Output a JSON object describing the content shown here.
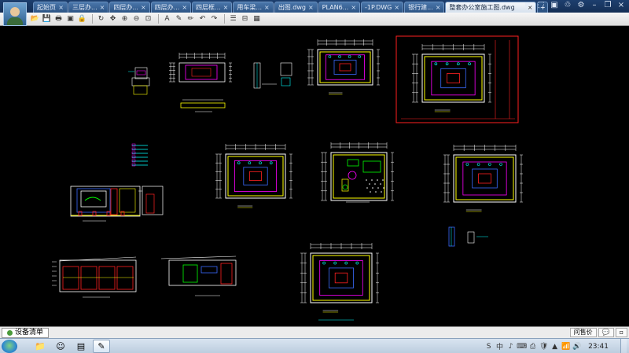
{
  "tabs": [
    {
      "label": "起始页",
      "active": false
    },
    {
      "label": "三层办...",
      "active": false
    },
    {
      "label": "四层办...",
      "active": false
    },
    {
      "label": "四层办...",
      "active": false
    },
    {
      "label": "四层框...",
      "active": false
    },
    {
      "label": "用车梁...",
      "active": false
    },
    {
      "label": "出图.dwg",
      "active": false
    },
    {
      "label": "PLAN6...",
      "active": false
    },
    {
      "label": "-1P.DWG",
      "active": false
    },
    {
      "label": "银行建...",
      "active": false
    },
    {
      "label": "整套办公室施工图.dwg",
      "active": true
    }
  ],
  "new_tab_symbol": "+",
  "close_symbol": "×",
  "window_controls": [
    "≡",
    "⬚",
    "▣",
    "♲",
    "⚙",
    "–",
    "❐",
    "×"
  ],
  "toolbar_icons": [
    "open-icon",
    "save-icon",
    "print-icon",
    "pdf-icon",
    "lock-icon",
    "rotate-icon",
    "pan-icon",
    "zoom-in-icon",
    "zoom-out-icon",
    "zoom-window-icon",
    "text-icon",
    "pen-icon",
    "pencil-icon",
    "undo-icon",
    "redo-icon",
    "layer-icon",
    "measure-icon",
    "layers-icon"
  ],
  "layout": {
    "tab_label": "设备清单",
    "right_buttons": [
      "问售价",
      "💬",
      "▫"
    ]
  },
  "taskbar": {
    "clock": "23:41",
    "tray_icons": [
      "S",
      "中",
      "♪",
      "⌨",
      "⎙",
      "🛡",
      "▲",
      "📶",
      "🔊"
    ]
  },
  "colors": {
    "canvas_bg": "#000000",
    "magenta": "#ff00ff",
    "yellow": "#ffff00",
    "cyan": "#00ffff",
    "red": "#ff2020",
    "green": "#00ff00",
    "white": "#ffffff",
    "blue": "#3a6bff"
  }
}
